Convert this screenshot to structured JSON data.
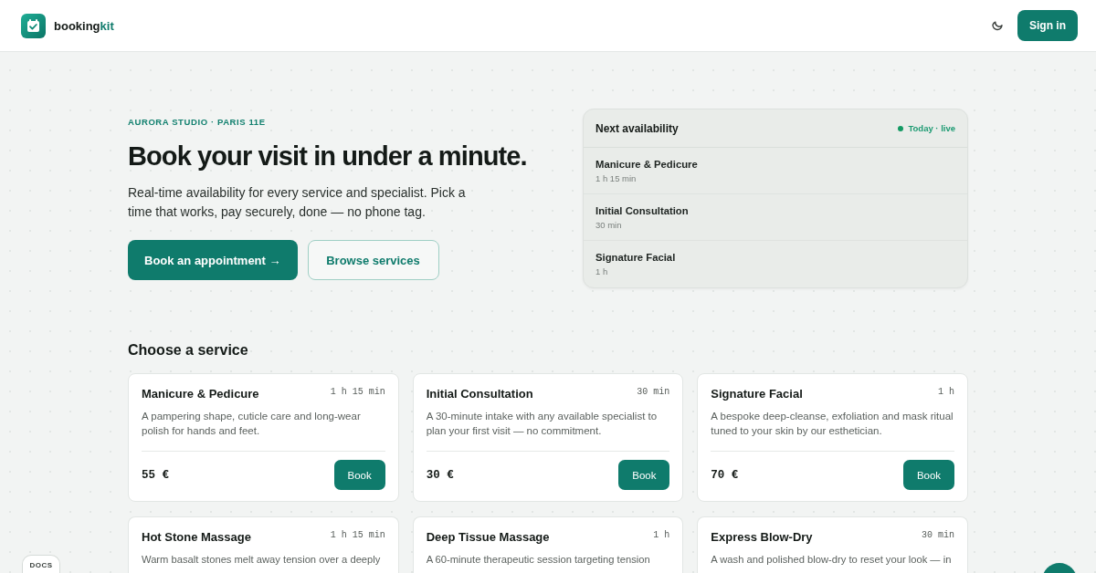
{
  "header": {
    "logo": {
      "text": "booking",
      "accent": "kit"
    },
    "sign_in": "Sign in"
  },
  "hero": {
    "eyebrow": "AURORA STUDIO · PARIS 11E",
    "title": "Book your visit in under a minute.",
    "subtitle": "Real-time availability for every service and specialist. Pick a time that works, pay securely, done — no phone tag.",
    "primary_button": "Book an appointment →",
    "secondary_button": "Browse services"
  },
  "availability": {
    "title": "Next availability",
    "status": "Today · live",
    "items": [
      {
        "name": "Manicure & Pedicure",
        "duration": "1 h 15 min"
      },
      {
        "name": "Initial Consultation",
        "duration": "30 min"
      },
      {
        "name": "Signature Facial",
        "duration": "1 h"
      }
    ]
  },
  "services": {
    "title": "Choose a service",
    "cards": [
      {
        "name": "Manicure & Pedicure",
        "duration": "1 h 15 min",
        "description": "A pampering shape, cuticle care and long-wear polish for hands and feet.",
        "price": "55 €",
        "button": "Book"
      },
      {
        "name": "Initial Consultation",
        "duration": "30 min",
        "description": "A 30-minute intake with any available specialist to plan your first visit — no commitment.",
        "price": "30 €",
        "button": "Book"
      },
      {
        "name": "Signature Facial",
        "duration": "1 h",
        "description": "A bespoke deep-cleanse, exfoliation and mask ritual tuned to your skin by our esthetician.",
        "price": "70 €",
        "button": "Book"
      },
      {
        "name": "Hot Stone Massage",
        "duration": "1 h 15 min",
        "description": "Warm basalt stones melt away tension over a deeply"
      },
      {
        "name": "Deep Tissue Massage",
        "duration": "1 h",
        "description": "A 60-minute therapeutic session targeting tension"
      },
      {
        "name": "Express Blow-Dry",
        "duration": "30 min",
        "description": "A wash and polished blow-dry to reset your look — in"
      }
    ]
  },
  "docs_tab": "DOCS"
}
